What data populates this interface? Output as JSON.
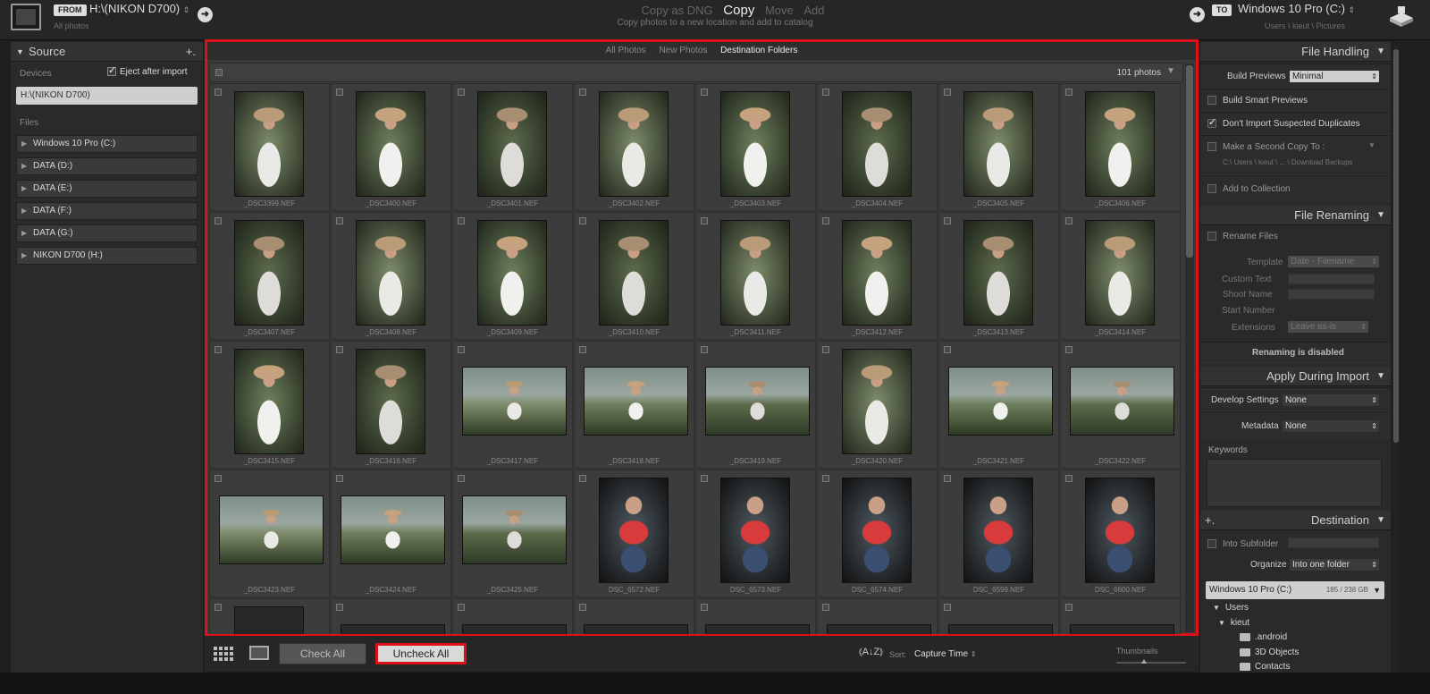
{
  "top": {
    "from_tag": "FROM",
    "from_path": "H:\\(NIKON D700)",
    "from_sub": "All photos",
    "modes": [
      "Copy as DNG",
      "Copy",
      "Move",
      "Add"
    ],
    "active_mode": "Copy",
    "mode_desc": "Copy photos to a new location and add to catalog",
    "to_tag": "TO",
    "to_path": "Windows 10 Pro (C:)",
    "to_sub": "Users \\ kieut \\ Pictures"
  },
  "source": {
    "title": "Source",
    "devices_label": "Devices",
    "eject_label": "Eject after import",
    "device": "H:\\(NIKON D700)",
    "files_label": "Files",
    "files": [
      "Windows 10 Pro (C:)",
      "DATA (D:)",
      "DATA (E:)",
      "DATA (F:)",
      "DATA (G:)",
      "NIKON D700 (H:)"
    ]
  },
  "center": {
    "tabs": [
      "All Photos",
      "New Photos",
      "Destination Folders"
    ],
    "active_tab": "Destination Folders",
    "count": "101 photos",
    "photos": [
      {
        "name": "_DSC3399.NEF",
        "o": "p"
      },
      {
        "name": "_DSC3400.NEF",
        "o": "p"
      },
      {
        "name": "_DSC3401.NEF",
        "o": "p"
      },
      {
        "name": "_DSC3402.NEF",
        "o": "p"
      },
      {
        "name": "_DSC3403.NEF",
        "o": "p"
      },
      {
        "name": "_DSC3404.NEF",
        "o": "p"
      },
      {
        "name": "_DSC3405.NEF",
        "o": "p"
      },
      {
        "name": "_DSC3406.NEF",
        "o": "p"
      },
      {
        "name": "_DSC3407.NEF",
        "o": "p"
      },
      {
        "name": "_DSC3408.NEF",
        "o": "p"
      },
      {
        "name": "_DSC3409.NEF",
        "o": "p"
      },
      {
        "name": "_DSC3410.NEF",
        "o": "p"
      },
      {
        "name": "_DSC3411.NEF",
        "o": "p"
      },
      {
        "name": "_DSC3412.NEF",
        "o": "p"
      },
      {
        "name": "_DSC3413.NEF",
        "o": "p"
      },
      {
        "name": "_DSC3414.NEF",
        "o": "p"
      },
      {
        "name": "_DSC3415.NEF",
        "o": "p"
      },
      {
        "name": "_DSC3416.NEF",
        "o": "p"
      },
      {
        "name": "_DSC3417.NEF",
        "o": "l"
      },
      {
        "name": "_DSC3418.NEF",
        "o": "l"
      },
      {
        "name": "_DSC3419.NEF",
        "o": "l"
      },
      {
        "name": "_DSC3420.NEF",
        "o": "p"
      },
      {
        "name": "_DSC3421.NEF",
        "o": "l"
      },
      {
        "name": "_DSC3422.NEF",
        "o": "l"
      },
      {
        "name": "_DSC3423.NEF",
        "o": "l"
      },
      {
        "name": "_DSC3424.NEF",
        "o": "l"
      },
      {
        "name": "_DSC3425.NEF",
        "o": "l"
      },
      {
        "name": "DSC_6572.NEF",
        "o": "p"
      },
      {
        "name": "DSC_6573.NEF",
        "o": "p"
      },
      {
        "name": "DSC_6574.NEF",
        "o": "p"
      },
      {
        "name": "DSC_6599.NEF",
        "o": "p"
      },
      {
        "name": "DSC_6600.NEF",
        "o": "p"
      },
      {
        "name": "",
        "o": "p"
      },
      {
        "name": "",
        "o": "l"
      },
      {
        "name": "",
        "o": "l"
      },
      {
        "name": "",
        "o": "l"
      },
      {
        "name": "",
        "o": "l"
      },
      {
        "name": "",
        "o": "l"
      },
      {
        "name": "",
        "o": "l"
      },
      {
        "name": "",
        "o": "l"
      }
    ]
  },
  "bottom": {
    "check_all": "Check All",
    "uncheck_all": "Uncheck All",
    "sort_label": "Sort:",
    "sort_value": "Capture Time",
    "thumbnails_label": "Thumbnails"
  },
  "right": {
    "file_handling": "File Handling",
    "build_previews_label": "Build Previews",
    "build_previews_value": "Minimal",
    "smart_previews": "Build Smart Previews",
    "no_duplicates": "Don't Import Suspected Duplicates",
    "second_copy": "Make a Second Copy To :",
    "second_copy_path": "C:\\ Users \\ kieut \\ ... \\ Download Backups",
    "add_collection": "Add to Collection",
    "file_renaming": "File Renaming",
    "rename_files": "Rename Files",
    "template_label": "Template",
    "template_value": "Date - Filename",
    "custom_text": "Custom Text",
    "shoot_name": "Shoot Name",
    "start_number": "Start Number",
    "extensions_label": "Extensions",
    "extensions_value": "Leave as-is",
    "renaming_disabled": "Renaming is disabled",
    "apply_during_import": "Apply During Import",
    "develop_label": "Develop Settings",
    "develop_value": "None",
    "metadata_label": "Metadata",
    "metadata_value": "None",
    "keywords_label": "Keywords",
    "destination": "Destination",
    "into_subfolder": "Into Subfolder",
    "organize_label": "Organize",
    "organize_value": "Into one folder",
    "volume": "Windows 10 Pro (C:)",
    "volume_cap": "185 / 238 GB",
    "tree": {
      "users": "Users",
      "kieut": "kieut",
      "folders": [
        ".android",
        "3D Objects",
        "Contacts"
      ]
    }
  }
}
